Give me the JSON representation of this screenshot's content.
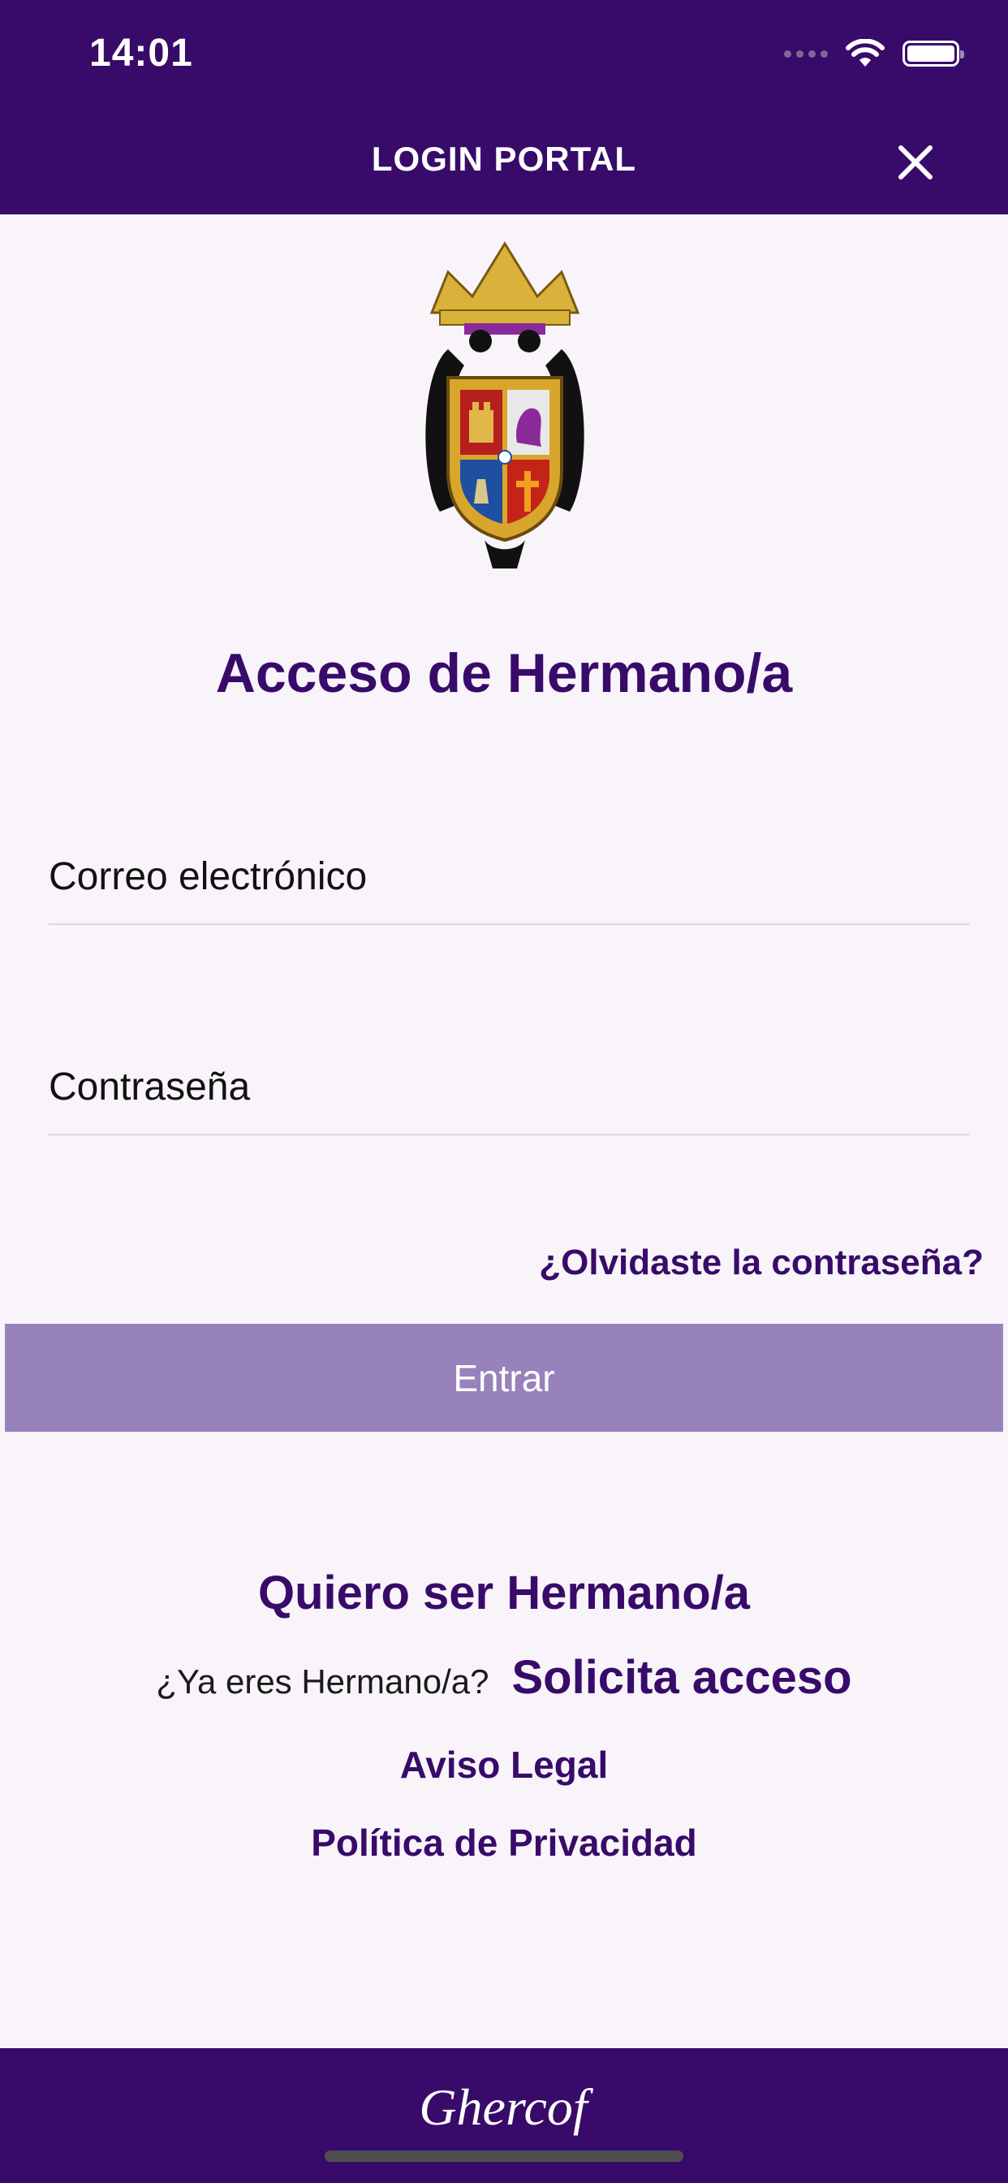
{
  "status_bar": {
    "time": "14:01"
  },
  "header": {
    "title": "LOGIN PORTAL"
  },
  "login": {
    "heading": "Acceso de Hermano/a",
    "email_placeholder": "Correo electrónico",
    "password_placeholder": "Contraseña",
    "forgot_label": "¿Olvidaste la contraseña?",
    "enter_label": "Entrar"
  },
  "links": {
    "want_member": "Quiero ser Hermano/a",
    "already_member_question": "¿Ya eres Hermano/a?",
    "request_access": "Solicita acceso",
    "legal_notice": "Aviso Legal",
    "privacy_policy": "Política de Privacidad"
  },
  "footer": {
    "logo_text": "Ghercof"
  },
  "colors": {
    "primary": "#380b6a",
    "button": "#9782bb",
    "background": "#f8f4fa"
  },
  "icons": [
    "signal-icon",
    "wifi-icon",
    "battery-icon",
    "close-icon",
    "crest-logo"
  ]
}
